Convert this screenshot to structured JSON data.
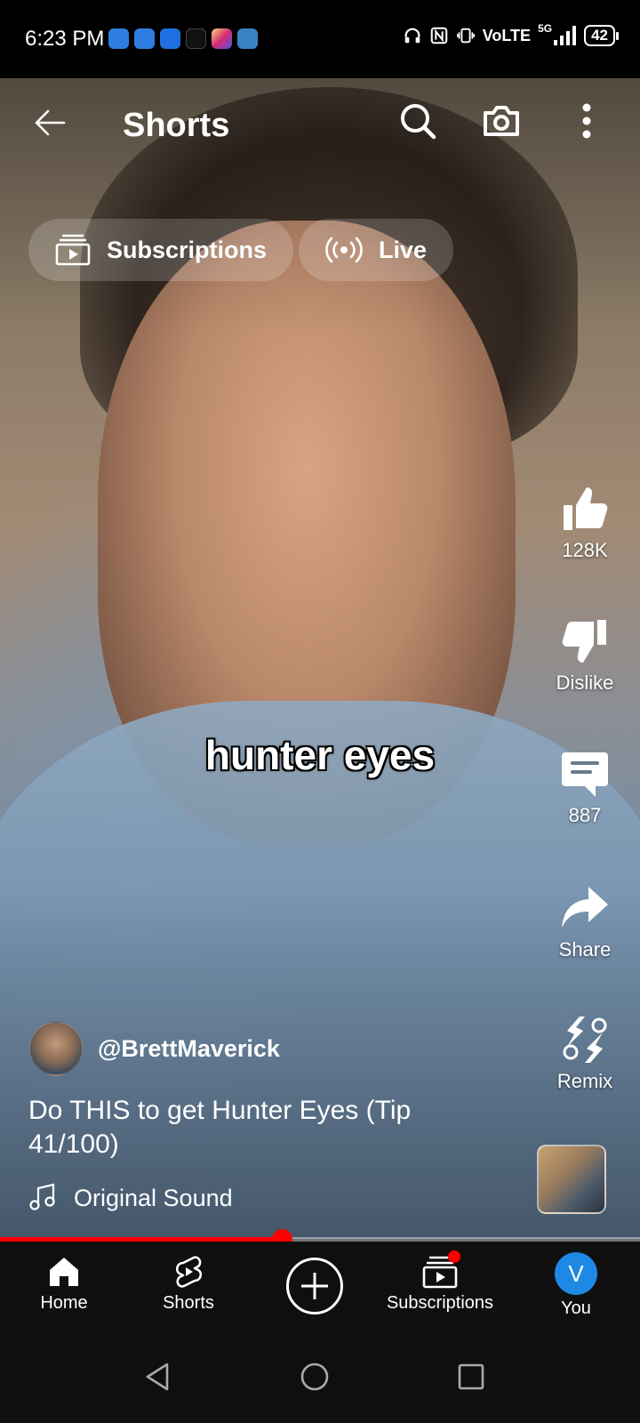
{
  "status_bar": {
    "time": "6:23 PM",
    "network": "VoLTE",
    "network_gen": "5G",
    "battery": "42",
    "notification_app_colors": [
      "#2f7de1",
      "#2f7de1",
      "#1f6fe0",
      "#111111",
      "#d6249f",
      "#3b82c4"
    ]
  },
  "header": {
    "title": "Shorts",
    "icons": [
      "back-arrow-icon",
      "search-icon",
      "camera-icon",
      "more-vert-icon"
    ]
  },
  "chips": [
    {
      "label": "Subscriptions",
      "icon": "subscriptions-icon"
    },
    {
      "label": "Live",
      "icon": "live-icon"
    }
  ],
  "video": {
    "caption": "hunter eyes"
  },
  "actions": {
    "like": "128K",
    "dislike": "Dislike",
    "comments": "887",
    "share": "Share",
    "remix": "Remix"
  },
  "channel": {
    "handle": "@BrettMaverick",
    "description": "Do THIS to get Hunter Eyes (Tip 41/100)",
    "sound": "Original Sound"
  },
  "progress": {
    "fraction": 0.44,
    "color": "#ff0000"
  },
  "bottom_nav": {
    "items": [
      {
        "label": "Home",
        "icon": "home-icon"
      },
      {
        "label": "Shorts",
        "icon": "shorts-icon"
      },
      {
        "label": "",
        "icon": "create-plus-icon"
      },
      {
        "label": "Subscriptions",
        "icon": "subscriptions-icon"
      },
      {
        "label": "You",
        "icon": "avatar"
      }
    ],
    "you_initial": "V",
    "avatar_color": "#1e88e5"
  },
  "system_nav": [
    "back-triangle-icon",
    "home-circle-icon",
    "recents-square-icon"
  ]
}
